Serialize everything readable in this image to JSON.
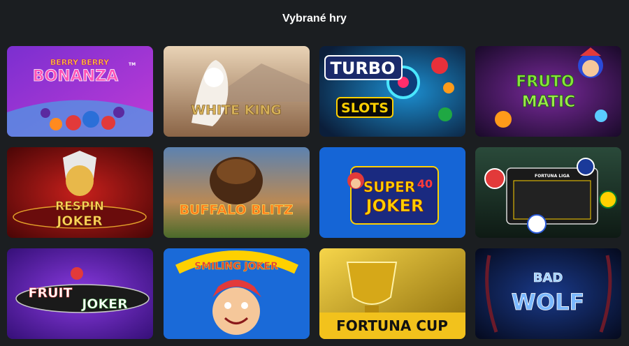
{
  "section": {
    "title": "Vybrané hry"
  },
  "games": [
    {
      "name": "Berry Berry Bonanza",
      "line1": "BERRY BERRY",
      "line2": "BONANZA",
      "tm": "TM"
    },
    {
      "name": "White King",
      "line1": "WHITE KING"
    },
    {
      "name": "Turbo Slots",
      "line1": "TURBO",
      "line2": "SLOTS"
    },
    {
      "name": "Fruto Matic",
      "line1": "FRUTO",
      "line2": "MATIC"
    },
    {
      "name": "Respin Joker",
      "line1": "RESPIN",
      "line2": "JOKER"
    },
    {
      "name": "Buffalo Blitz",
      "line1": "BUFFALO BLITZ"
    },
    {
      "name": "Super Joker 40",
      "line1": "SUPER",
      "line2": "JOKER",
      "badge": "40"
    },
    {
      "name": "Fortuna Liga",
      "line1": "FORTUNA LIGA"
    },
    {
      "name": "Fruit Joker",
      "line1": "FRUIT",
      "line2": "JOKER"
    },
    {
      "name": "Smiling Joker",
      "line1": "SMILING JOKER"
    },
    {
      "name": "Fortuna Cup",
      "line1": "FORTUNA CUP"
    },
    {
      "name": "Bad Wolf",
      "line1": "BAD",
      "line2": "WOLF"
    }
  ]
}
